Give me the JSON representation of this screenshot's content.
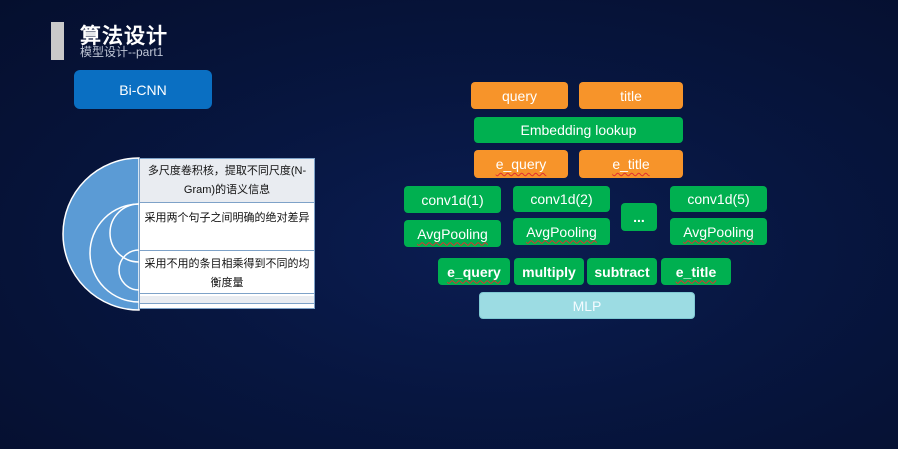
{
  "header": {
    "title": "算法设计",
    "subtitle": "模型设计--part1"
  },
  "model_label": "Bi-CNN",
  "feature_list": [
    "多尺度卷积核，提取不同尺度(N-Gram)的语义信息",
    "采用两个句子之间明确的绝对差异",
    "采用不用的条目相乘得到不同的均衡度量"
  ],
  "diagram": {
    "inputs": [
      "query",
      "title"
    ],
    "embedding": "Embedding lookup",
    "embedded": [
      "e_query",
      "e_title"
    ],
    "convs": [
      "conv1d(1)",
      "conv1d(2)",
      "conv1d(5)"
    ],
    "ellipsis": "...",
    "pooling": [
      "AvgPooling",
      "AvgPooling",
      "AvgPooling"
    ],
    "features": [
      "e_query",
      "multiply",
      "subtract",
      "e_title"
    ],
    "output": "MLP"
  },
  "colors": {
    "orange": "#f7942a",
    "green": "#00b050",
    "mlp": "#9cdce3",
    "blue_button": "#0a6fc2",
    "background": "#071640"
  }
}
